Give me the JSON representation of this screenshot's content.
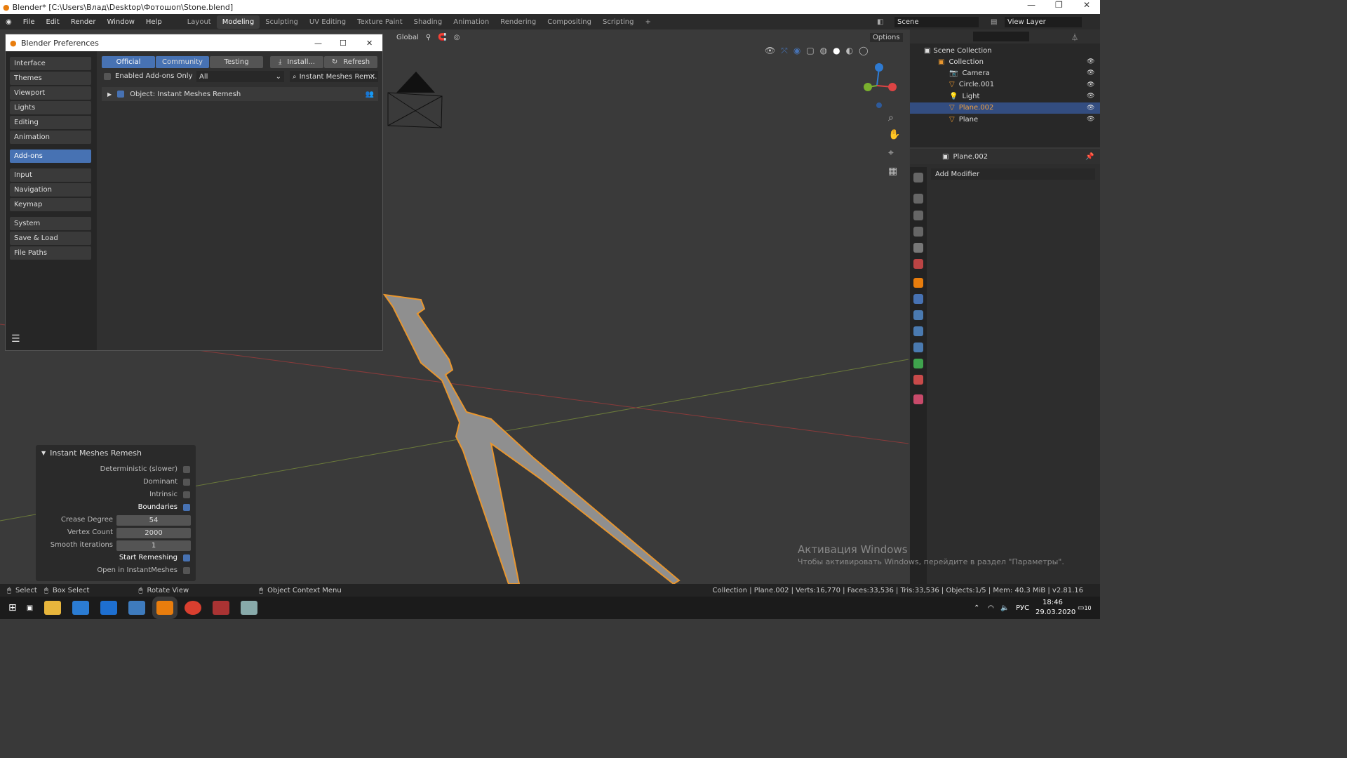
{
  "window": {
    "title": "Blender* [C:\\Users\\Влад\\Desktop\\Фотошоп\\Stone.blend]"
  },
  "menu": [
    "File",
    "Edit",
    "Render",
    "Window",
    "Help"
  ],
  "workspaces": [
    {
      "label": "Layout",
      "active": false
    },
    {
      "label": "Modeling",
      "active": true
    },
    {
      "label": "Sculpting",
      "active": false
    },
    {
      "label": "UV Editing",
      "active": false
    },
    {
      "label": "Texture Paint",
      "active": false
    },
    {
      "label": "Shading",
      "active": false
    },
    {
      "label": "Animation",
      "active": false
    },
    {
      "label": "Rendering",
      "active": false
    },
    {
      "label": "Compositing",
      "active": false
    },
    {
      "label": "Scripting",
      "active": false
    },
    {
      "label": "+",
      "active": false
    }
  ],
  "scene": {
    "label": "Scene"
  },
  "view_layer": {
    "label": "View Layer"
  },
  "viewport_header": {
    "orientation": "Global",
    "options": "Options"
  },
  "prefs": {
    "title": "Blender Preferences",
    "nav": [
      "Interface",
      "Themes",
      "Viewport",
      "Lights",
      "Editing",
      "Animation",
      "Add-ons",
      "Input",
      "Navigation",
      "Keymap",
      "System",
      "Save & Load",
      "File Paths"
    ],
    "active_nav": "Add-ons",
    "tabs": {
      "official": "Official",
      "community": "Community",
      "testing": "Testing",
      "install": "Install...",
      "refresh": "Refresh"
    },
    "enabled_only": "Enabled Add-ons Only",
    "category": "All",
    "search": "Instant Meshes Rem...",
    "addon": "Object: Instant Meshes Remesh"
  },
  "outliner": {
    "root": "Scene Collection",
    "items": [
      {
        "label": "Collection",
        "selected": false
      },
      {
        "label": "Camera",
        "selected": false
      },
      {
        "label": "Circle.001",
        "selected": false
      },
      {
        "label": "Light",
        "selected": false
      },
      {
        "label": "Plane.002",
        "selected": true
      },
      {
        "label": "Plane",
        "selected": false
      }
    ]
  },
  "properties": {
    "object": "Plane.002",
    "add_modifier": "Add Modifier"
  },
  "op_panel": {
    "title": "Instant Meshes Remesh",
    "deterministic": "Deterministic (slower)",
    "dominant": "Dominant",
    "intrinsic": "Intrinsic",
    "boundaries": "Boundaries",
    "crease_label": "Crease Degree",
    "crease_value": "54",
    "vertex_label": "Vertex Count",
    "vertex_value": "2000",
    "smooth_label": "Smooth iterations",
    "smooth_value": "1",
    "start": "Start Remeshing",
    "open": "Open in InstantMeshes"
  },
  "watermark": {
    "line1": "Активация Windows",
    "line2": "Чтобы активировать Windows, перейдите в раздел \"Параметры\"."
  },
  "status": {
    "select": "Select",
    "box_select": "Box Select",
    "rotate": "Rotate View",
    "context": "Object Context Menu",
    "stats": "Collection | Plane.002 | Verts:16,770 | Faces:33,536 | Tris:33,536 | Objects:1/5 | Mem: 40.3 MiB | v2.81.16"
  },
  "taskbar": {
    "lang": "РУС",
    "time": "18:46",
    "date": "29.03.2020",
    "notif": "10"
  },
  "colors": {
    "accent": "#4772b3",
    "selection": "#334d80",
    "object_outline": "#e8962f"
  }
}
